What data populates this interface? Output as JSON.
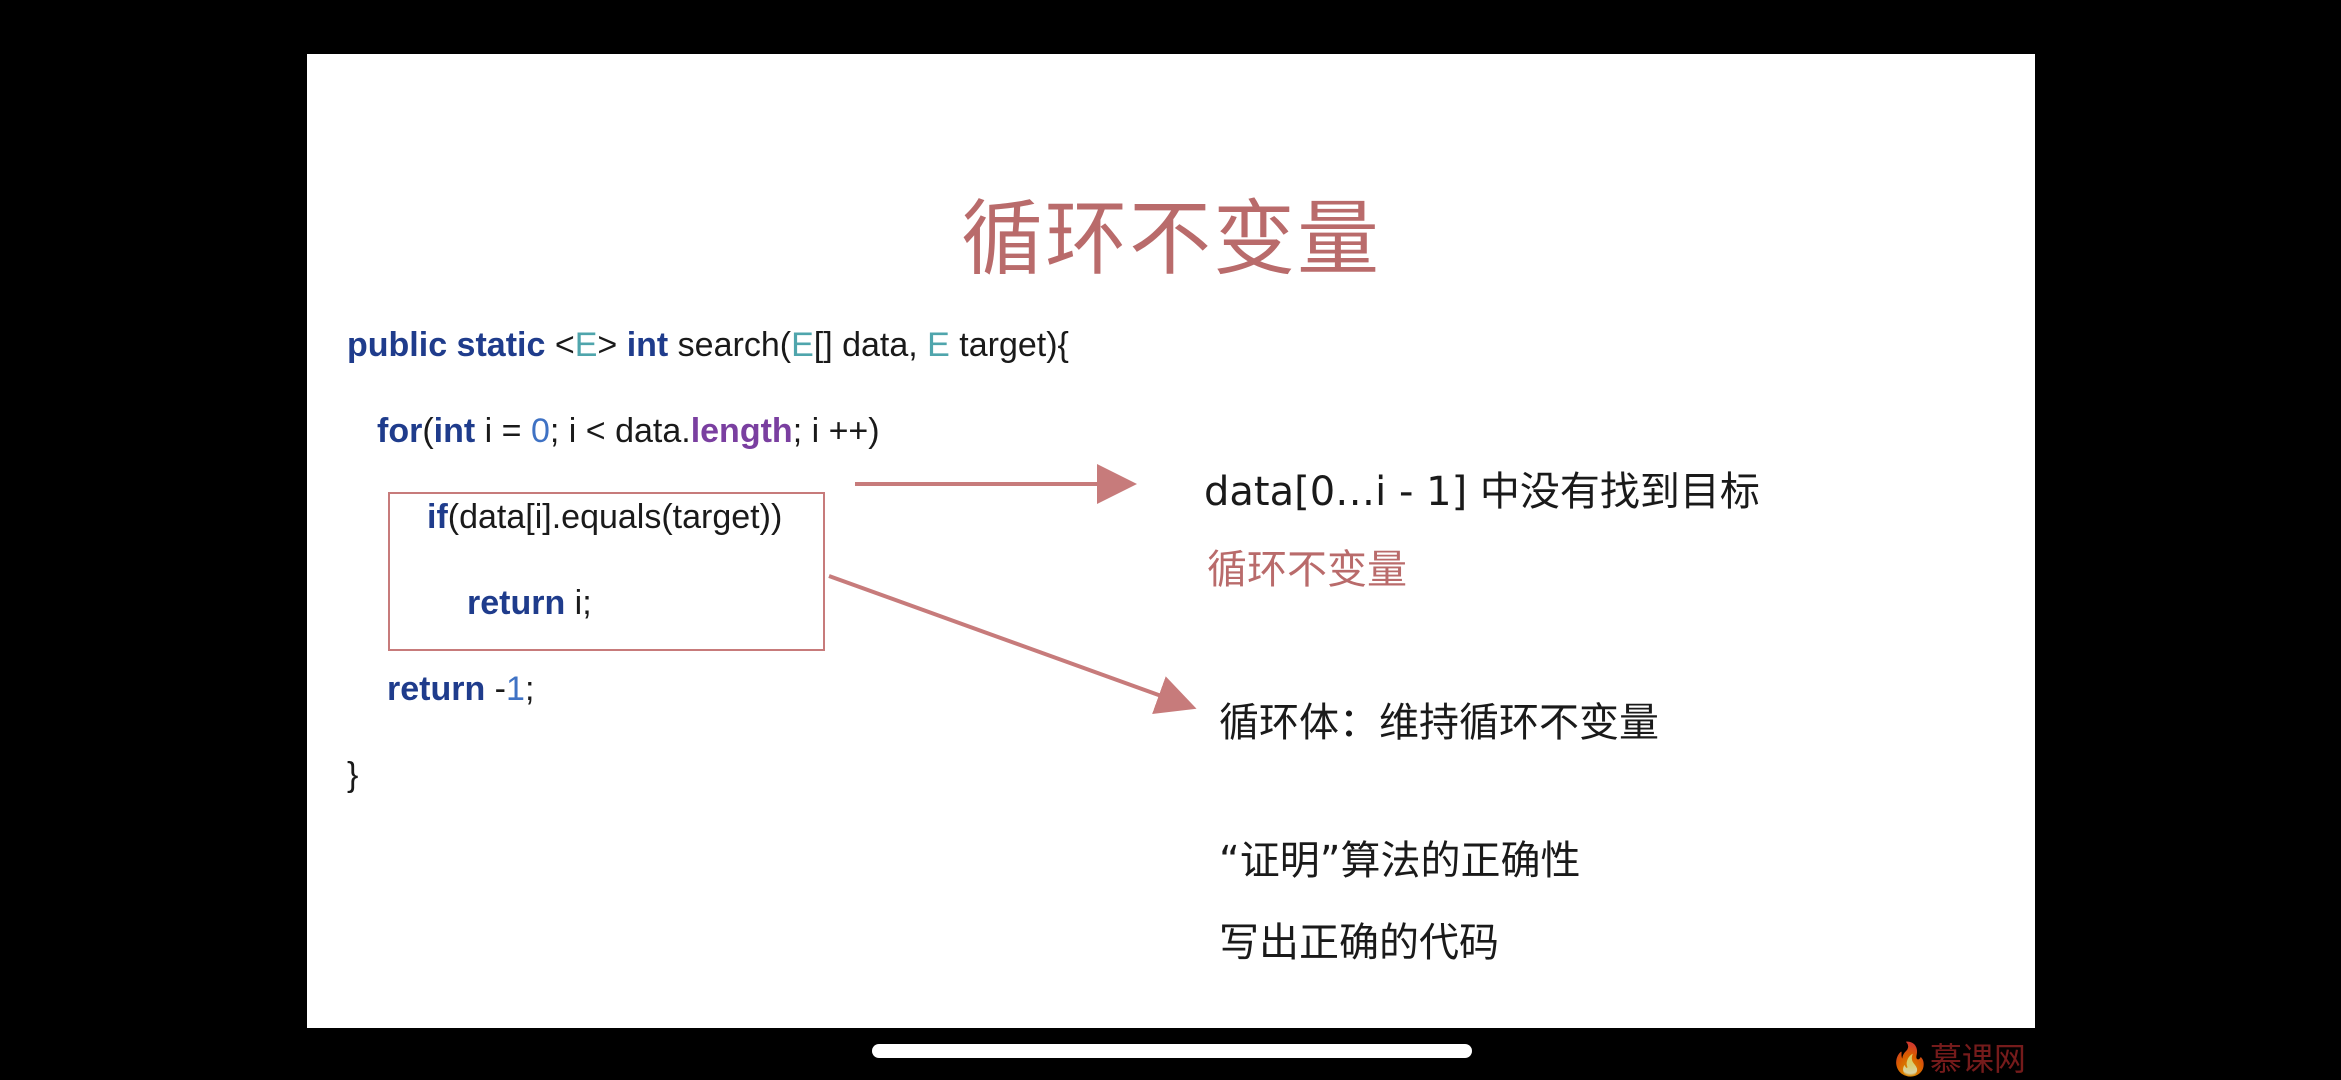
{
  "slide": {
    "title": "循环不变量",
    "code": {
      "line1": {
        "kw1": "public static",
        "lt": " <",
        "t1": "E",
        "gt": "> ",
        "kw2": "int",
        "mid": " search(",
        "t2": "E",
        "mid2": "[] data, ",
        "t3": "E",
        "end": " target){"
      },
      "line2": {
        "kw1": "for",
        "p1": "(",
        "kw2": "int",
        "mid": " i = ",
        "num": "0",
        "mid2": "; i < data.",
        "field": "length",
        "end": "; i ++)"
      },
      "line3": {
        "kw": "if",
        "rest": "(data[i].equals(target))"
      },
      "line4": {
        "kw": "return",
        "rest": " i;"
      },
      "line5": {
        "kw": "return",
        "mid": " -",
        "num": "1",
        "end": ";"
      },
      "line6": "}"
    },
    "notes": {
      "invariant_desc": "data[0…i - 1] 中没有找到目标",
      "invariant_label": "循环不变量",
      "loop_body": "循环体：维持循环不变量",
      "prove": "“证明”算法的正确性",
      "write_code": "写出正确的代码"
    }
  },
  "watermark": "慕课网",
  "colors": {
    "title": "#b96b6b",
    "keyword": "#1f3c8c",
    "type_param": "#4fa5ac",
    "number": "#3f72c4",
    "field": "#7a3fa0",
    "arrow": "#c77b7b"
  }
}
